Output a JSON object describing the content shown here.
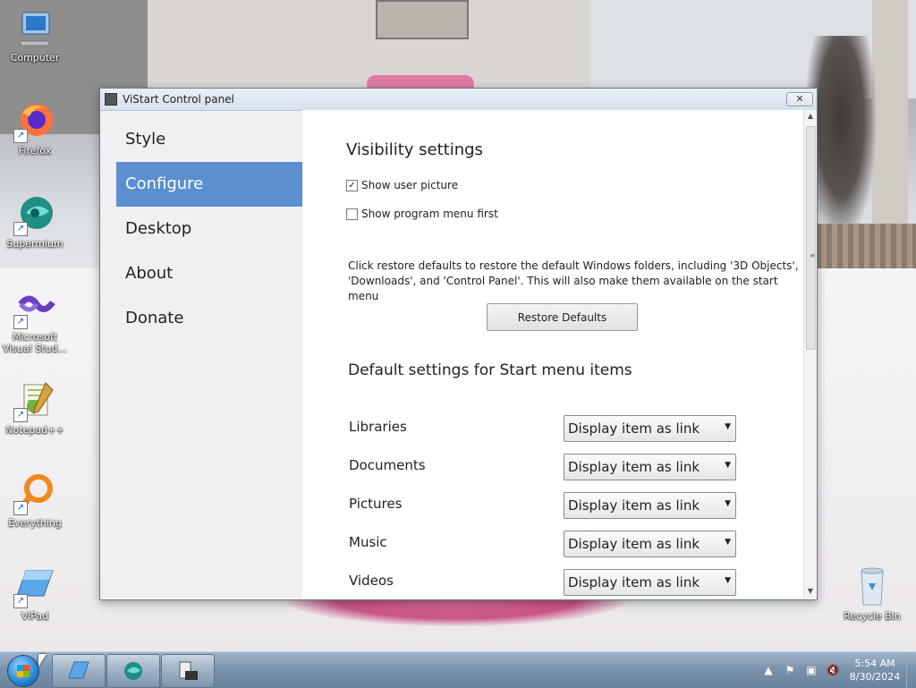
{
  "desktop": {
    "icons": [
      {
        "label": "Computer",
        "icon": "computer-icon"
      },
      {
        "label": "Firefox",
        "icon": "firefox-icon"
      },
      {
        "label": "Supermium",
        "icon": "supermium-icon"
      },
      {
        "label": "Microsoft Visual Stud...",
        "icon": "visual-studio-icon"
      },
      {
        "label": "Notepad++",
        "icon": "notepadpp-icon"
      },
      {
        "label": "Everything",
        "icon": "everything-icon"
      },
      {
        "label": "ViPad",
        "icon": "vipad-icon"
      },
      {
        "label": "Recycle Bin",
        "icon": "recycle-bin-icon"
      }
    ]
  },
  "window": {
    "title": "ViStart Control panel",
    "close_glyph": "✕",
    "sidebar": {
      "items": [
        {
          "label": "Style",
          "active": false
        },
        {
          "label": "Configure",
          "active": true
        },
        {
          "label": "Desktop",
          "active": false
        },
        {
          "label": "About",
          "active": false
        },
        {
          "label": "Donate",
          "active": false
        }
      ]
    },
    "content": {
      "visibility_heading": "Visibility settings",
      "checkboxes": [
        {
          "label": "Show user picture",
          "checked": true
        },
        {
          "label": "Show program menu first",
          "checked": false
        }
      ],
      "restore_text": "Click restore defaults to restore the default Windows folders, including '3D Objects', 'Downloads', and 'Control Panel'. This will also make them available on the start menu",
      "restore_button": "Restore Defaults",
      "defaults_heading": "Default settings for Start menu items",
      "items": [
        {
          "label": "Libraries",
          "value": "Display item as link"
        },
        {
          "label": "Documents",
          "value": "Display item as link"
        },
        {
          "label": "Pictures",
          "value": "Display item as link"
        },
        {
          "label": "Music",
          "value": "Display item as link"
        },
        {
          "label": "Videos",
          "value": "Display item as link"
        }
      ]
    }
  },
  "taskbar": {
    "pinned": [
      {
        "name": "vipad-taskbar-button",
        "icon": "vipad-icon"
      },
      {
        "name": "supermium-taskbar-button",
        "icon": "supermium-icon"
      },
      {
        "name": "vistart-taskbar-button",
        "icon": "vistart-control-panel-icon"
      }
    ],
    "clock": {
      "time": "5:54 AM",
      "date": "8/30/2024"
    },
    "tray_glyphs": {
      "chevron": "▲",
      "flag": "⚑",
      "network": "▣",
      "volume": "🔇"
    }
  },
  "colors": {
    "accent": "#5b8fcf",
    "taskbar": "#7b94ae"
  }
}
